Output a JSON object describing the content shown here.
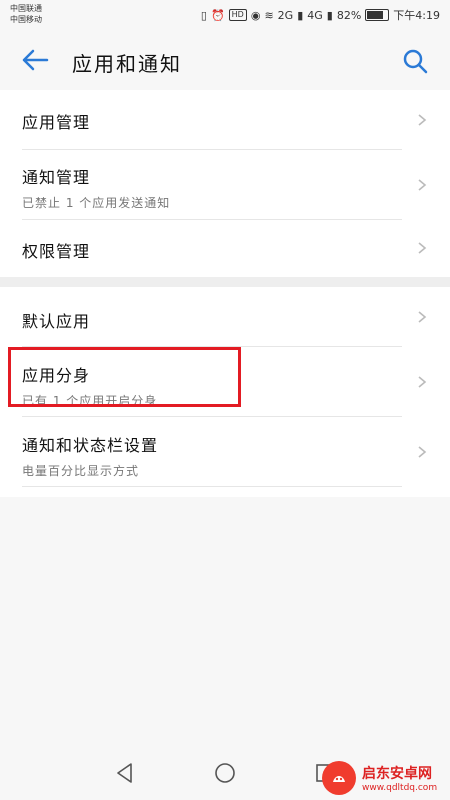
{
  "status_bar": {
    "carrier1": "中国联通",
    "carrier2": "中国移动",
    "hd_badge": "HD",
    "net1": "2G",
    "net2": "4G",
    "battery": "82%",
    "time": "下午4:19"
  },
  "header": {
    "title": "应用和通知",
    "back_icon": "back-arrow-icon",
    "search_icon": "search-icon"
  },
  "section1": [
    {
      "title": "应用管理",
      "subtitle": ""
    },
    {
      "title": "通知管理",
      "subtitle": "已禁止 1 个应用发送通知"
    },
    {
      "title": "权限管理",
      "subtitle": ""
    }
  ],
  "section2": [
    {
      "title": "默认应用",
      "subtitle": ""
    },
    {
      "title": "应用分身",
      "subtitle": "已有 1 个应用开启分身"
    },
    {
      "title": "通知和状态栏设置",
      "subtitle": "电量百分比显示方式"
    }
  ],
  "watermark": {
    "name": "启东安卓网",
    "url": "www.qdltdq.com"
  },
  "colors": {
    "accent": "#2b7ad6",
    "highlight": "#e31b23",
    "background": "#f7f7f7"
  }
}
